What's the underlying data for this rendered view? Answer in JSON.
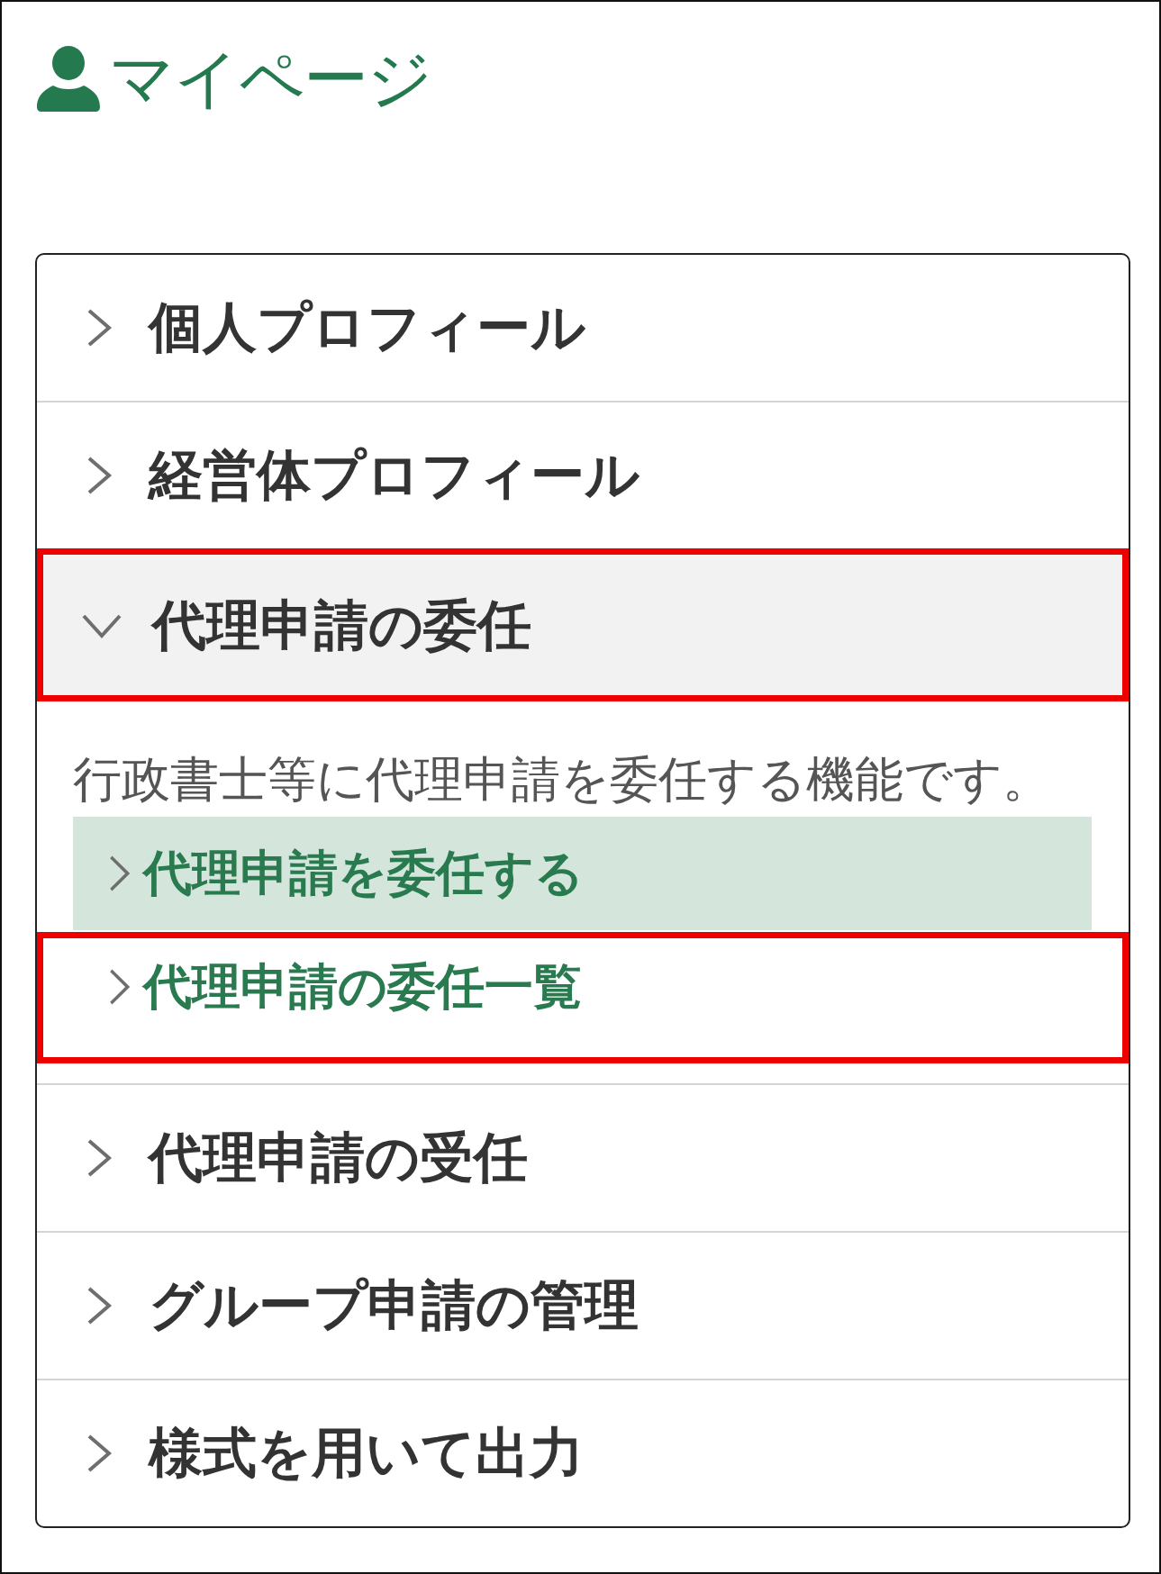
{
  "header": {
    "title": "マイページ"
  },
  "menu": {
    "items": [
      {
        "label": "個人プロフィール",
        "expanded": false,
        "highlighted": false
      },
      {
        "label": "経営体プロフィール",
        "expanded": false,
        "highlighted": false
      },
      {
        "label": "代理申請の委任",
        "expanded": true,
        "highlighted": true,
        "description": "行政書士等に代理申請を委任する機能です。",
        "children": [
          {
            "label": "代理申請を委任する",
            "selected": true,
            "highlighted": false
          },
          {
            "label": "代理申請の委任一覧",
            "selected": false,
            "highlighted": true
          }
        ]
      },
      {
        "label": "代理申請の受任",
        "expanded": false,
        "highlighted": false
      },
      {
        "label": "グループ申請の管理",
        "expanded": false,
        "highlighted": false
      },
      {
        "label": "様式を用いて出力",
        "expanded": false,
        "highlighted": false
      }
    ]
  }
}
